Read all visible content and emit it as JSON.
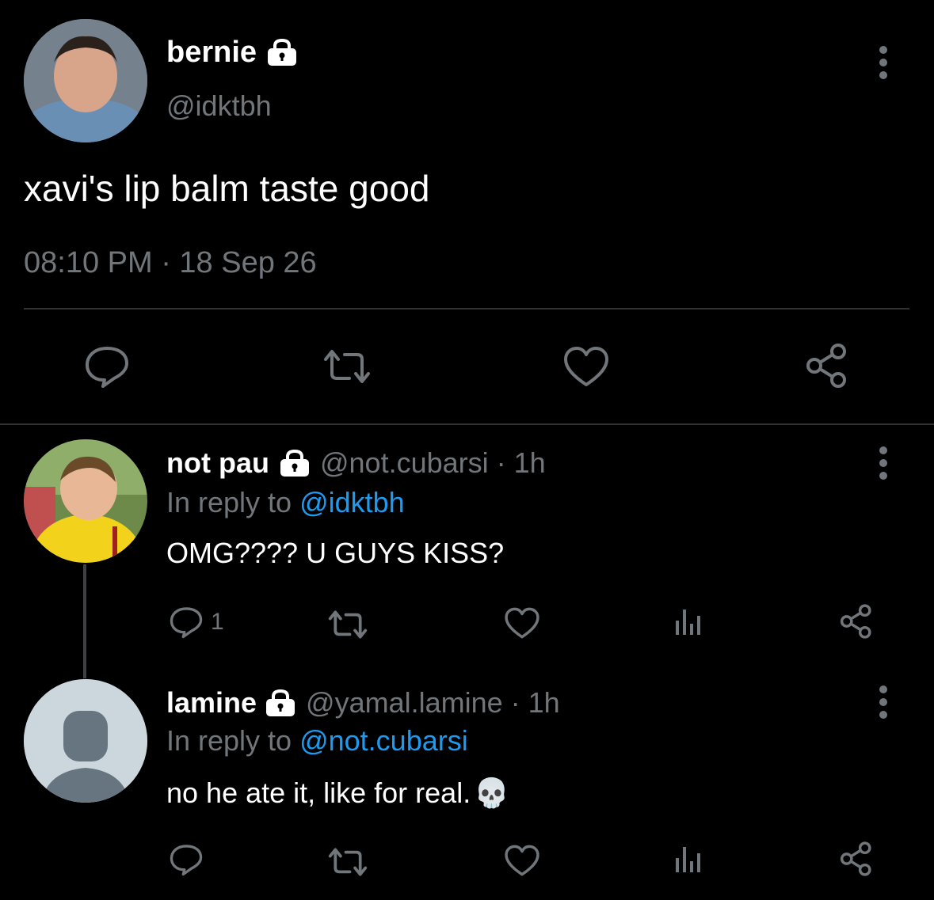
{
  "main_tweet": {
    "display_name": "bernie",
    "handle": "@idktbh",
    "text": "xavi's lip balm taste good",
    "timestamp": "08:10 PM · 18 Sep 26"
  },
  "replies": [
    {
      "display_name": "not pau",
      "handle": "@not.cubarsi · 1h",
      "reply_prefix": "In reply to ",
      "reply_mention": "@idktbh",
      "text": "OMG???? U GUYS KISS?",
      "reply_count": "1"
    },
    {
      "display_name": "lamine",
      "handle": "@yamal.lamine · 1h",
      "reply_prefix": "In reply to ",
      "reply_mention": "@not.cubarsi",
      "text": "no he ate it, like for real.",
      "emoji": "💀",
      "reply_count": ""
    }
  ],
  "colors": {
    "background": "#000000",
    "text_primary": "#ffffff",
    "text_secondary": "#71767b",
    "link": "#1d9bf0",
    "divider": "#2f3336"
  },
  "icons": {
    "lock": "lock-icon",
    "reply": "reply-icon",
    "retweet": "retweet-icon",
    "like": "heart-icon",
    "views": "views-icon",
    "share": "share-icon",
    "more": "more-icon"
  }
}
